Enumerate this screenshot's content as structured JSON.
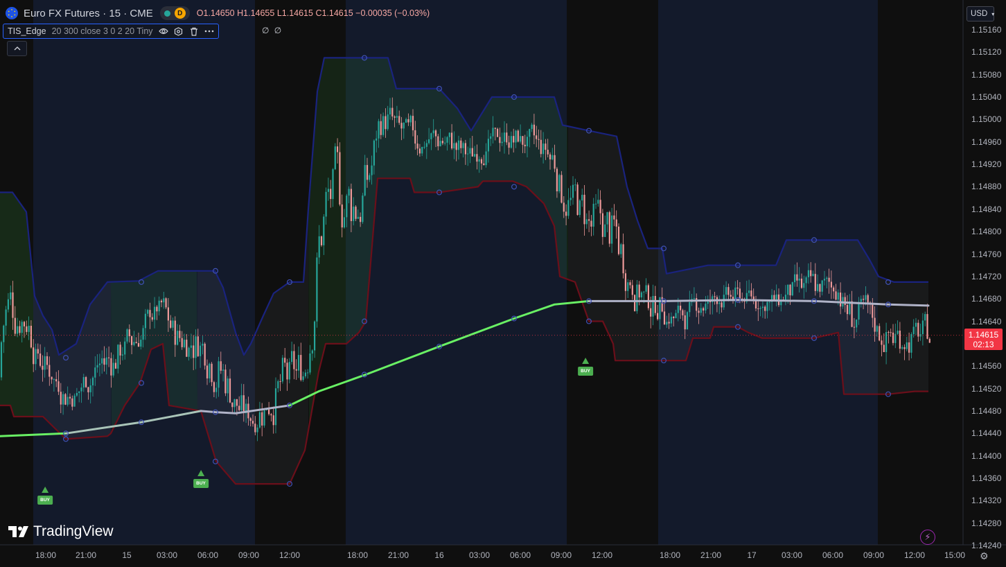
{
  "legend": {
    "symbol": "Euro FX Futures · 15 · CME",
    "status_letter": "D",
    "open": "O1.14650",
    "high": "H1.14655",
    "low": "L1.14615",
    "close": "C1.14615",
    "change": "−0.00035 (−0.03%)"
  },
  "indicator": {
    "name": "TIS_Edge",
    "params": "20 300 close 3 0 2 20 Tiny",
    "values": "∅ ∅",
    "icons": [
      "eye-icon",
      "settings-icon",
      "trash-icon",
      "more-icon"
    ]
  },
  "currency": "USD",
  "price_tag": {
    "price": "1.14615",
    "countdown": "02:13"
  },
  "branding": "TradingView",
  "signals": [
    "BUY",
    "BUY",
    "BUY"
  ],
  "colors": {
    "background": "#0f0f0f",
    "session_band": "#131a2b",
    "up_candle": "#26a69a",
    "down_candle": "#ef9a9a",
    "upper_band": "#1a237e",
    "lower_band": "#6b0f1a",
    "trend_ma_bull": "#69f064",
    "trend_ma_neutral": "#b0b3c8",
    "buy_signal": "#4caf50",
    "price_line": "#f23645"
  },
  "chart_data": {
    "type": "candlestick",
    "y_ticks": [
      "1.15160",
      "1.15120",
      "1.15080",
      "1.15040",
      "1.15000",
      "1.14960",
      "1.14920",
      "1.14880",
      "1.14840",
      "1.14800",
      "1.14760",
      "1.14720",
      "1.14680",
      "1.14640",
      "1.14560",
      "1.14520",
      "1.14480",
      "1.14440",
      "1.14400",
      "1.14360",
      "1.14320",
      "1.14280",
      "1.14240"
    ],
    "ylim": [
      1.1424,
      1.15176
    ],
    "x_ticks": [
      "18:00",
      "21:00",
      "15",
      "03:00",
      "06:00",
      "09:00",
      "12:00",
      "18:00",
      "21:00",
      "16",
      "03:00",
      "06:00",
      "09:00",
      "12:00",
      "18:00",
      "21:00",
      "17",
      "03:00",
      "06:00",
      "09:00",
      "12:00",
      "15:00"
    ],
    "last_price": 1.14615,
    "series": [
      {
        "name": "Upper band",
        "points": [
          [
            0,
            1.1487
          ],
          [
            18,
            1.1487
          ],
          [
            38,
            1.14835
          ],
          [
            50,
            1.14685
          ],
          [
            62,
            1.1465
          ],
          [
            75,
            1.14625
          ],
          [
            85,
            1.1458
          ],
          [
            110,
            1.146
          ],
          [
            130,
            1.1467
          ],
          [
            155,
            1.1471
          ],
          [
            200,
            1.14712
          ],
          [
            228,
            1.1473
          ],
          [
            262,
            1.1473
          ],
          [
            285,
            1.1473
          ],
          [
            310,
            1.1473
          ],
          [
            322,
            1.147
          ],
          [
            340,
            1.1462
          ],
          [
            352,
            1.1458
          ],
          [
            362,
            1.146
          ],
          [
            380,
            1.1465
          ],
          [
            395,
            1.1469
          ],
          [
            418,
            1.1471
          ],
          [
            438,
            1.1471
          ],
          [
            445,
            1.1484
          ],
          [
            458,
            1.1505
          ],
          [
            468,
            1.1511
          ],
          [
            560,
            1.1511
          ],
          [
            572,
            1.15055
          ],
          [
            634,
            1.15055
          ],
          [
            660,
            1.1502
          ],
          [
            680,
            1.1498
          ],
          [
            710,
            1.1504
          ],
          [
            800,
            1.1504
          ],
          [
            812,
            1.1499
          ],
          [
            850,
            1.1498
          ],
          [
            890,
            1.1497
          ],
          [
            905,
            1.1488
          ],
          [
            920,
            1.1482
          ],
          [
            935,
            1.1477
          ],
          [
            956,
            1.1477
          ],
          [
            962,
            1.14725
          ],
          [
            1022,
            1.1474
          ],
          [
            1065,
            1.1474
          ],
          [
            1120,
            1.1474
          ],
          [
            1135,
            1.14785
          ],
          [
            1238,
            1.14785
          ],
          [
            1255,
            1.1475
          ],
          [
            1268,
            1.1472
          ],
          [
            1290,
            1.1471
          ],
          [
            1340,
            1.1471
          ]
        ]
      },
      {
        "name": "Lower band",
        "points": [
          [
            0,
            1.1449
          ],
          [
            15,
            1.1449
          ],
          [
            20,
            1.1447
          ],
          [
            62,
            1.1447
          ],
          [
            95,
            1.1443
          ],
          [
            155,
            1.14435
          ],
          [
            160,
            1.1444
          ],
          [
            180,
            1.1449
          ],
          [
            202,
            1.1453
          ],
          [
            218,
            1.1459
          ],
          [
            235,
            1.146
          ],
          [
            244,
            1.1449
          ],
          [
            290,
            1.1448
          ],
          [
            312,
            1.1439
          ],
          [
            340,
            1.1435
          ],
          [
            418,
            1.1435
          ],
          [
            440,
            1.1441
          ],
          [
            460,
            1.1455
          ],
          [
            470,
            1.146
          ],
          [
            500,
            1.146
          ],
          [
            518,
            1.1462
          ],
          [
            528,
            1.1464
          ],
          [
            545,
            1.14895
          ],
          [
            592,
            1.14895
          ],
          [
            598,
            1.1487
          ],
          [
            634,
            1.1487
          ],
          [
            690,
            1.1488
          ],
          [
            697,
            1.1489
          ],
          [
            740,
            1.1489
          ],
          [
            760,
            1.1488
          ],
          [
            785,
            1.1485
          ],
          [
            800,
            1.1481
          ],
          [
            808,
            1.1472
          ],
          [
            830,
            1.1471
          ],
          [
            850,
            1.1464
          ],
          [
            870,
            1.1464
          ],
          [
            885,
            1.146
          ],
          [
            888,
            1.1457
          ],
          [
            958,
            1.1457
          ],
          [
            990,
            1.1457
          ],
          [
            1000,
            1.1461
          ],
          [
            1025,
            1.1461
          ],
          [
            1030,
            1.1463
          ],
          [
            1065,
            1.1463
          ],
          [
            1080,
            1.1462
          ],
          [
            1100,
            1.1461
          ],
          [
            1175,
            1.1461
          ],
          [
            1210,
            1.1462
          ],
          [
            1218,
            1.1451
          ],
          [
            1282,
            1.1451
          ],
          [
            1320,
            1.14515
          ],
          [
            1340,
            1.14515
          ]
        ]
      },
      {
        "name": "Trend MA",
        "points": [
          [
            0,
            1.14435
          ],
          [
            95,
            1.1444
          ],
          [
            204,
            1.1446
          ],
          [
            290,
            1.1448
          ],
          [
            311,
            1.14478
          ],
          [
            340,
            1.14476
          ],
          [
            418,
            1.1449
          ],
          [
            460,
            1.14515
          ],
          [
            528,
            1.14545
          ],
          [
            634,
            1.14595
          ],
          [
            742,
            1.14645
          ],
          [
            800,
            1.1467
          ],
          [
            850,
            1.14676
          ],
          [
            958,
            1.14676
          ],
          [
            1065,
            1.14678
          ],
          [
            1175,
            1.14676
          ],
          [
            1282,
            1.1467
          ],
          [
            1340,
            1.14668
          ]
        ]
      }
    ]
  }
}
